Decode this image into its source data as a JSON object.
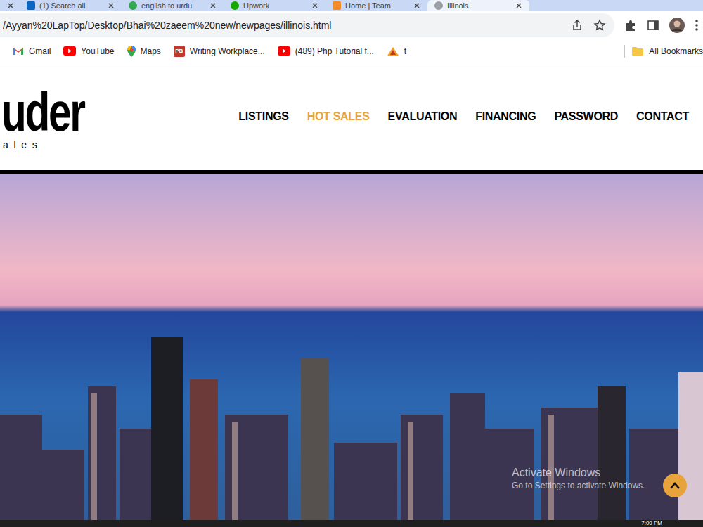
{
  "browser": {
    "tabs": [
      {
        "label": "(1) Search all",
        "kind": "linkedin",
        "selected": false
      },
      {
        "label": "english to urdu",
        "kind": "google",
        "selected": false
      },
      {
        "label": "Upwork",
        "kind": "upwork",
        "selected": false
      },
      {
        "label": "Home | Team",
        "kind": "site",
        "selected": false
      },
      {
        "label": "Illinois",
        "kind": "globe",
        "selected": true
      }
    ],
    "address": "/Ayyan%20LapTop/Desktop/Bhai%20zaeem%20new/newpages/illinois.html",
    "bookmarks": [
      {
        "label": "Gmail",
        "kind": "gmail"
      },
      {
        "label": "YouTube",
        "kind": "youtube"
      },
      {
        "label": "Maps",
        "kind": "maps"
      },
      {
        "label": "Writing Workplace...",
        "kind": "badge",
        "badge": "PB"
      },
      {
        "label": "(489) Php Tutorial f...",
        "kind": "youtube"
      },
      {
        "label": "t",
        "kind": "pma"
      }
    ],
    "all_bookmarks": "All Bookmarks"
  },
  "site": {
    "logo": {
      "main": "uder",
      "sub": "ales"
    },
    "nav": [
      {
        "label": "LISTINGS",
        "selected": false
      },
      {
        "label": "HOT SALES",
        "selected": true
      },
      {
        "label": "EVALUATION",
        "selected": false
      },
      {
        "label": "FINANCING",
        "selected": false
      },
      {
        "label": "PASSWORD",
        "selected": false
      },
      {
        "label": "CONTACT",
        "selected": false
      }
    ]
  },
  "windows_watermark": {
    "title": "Activate Windows",
    "subtitle": "Go to Settings to activate Windows."
  },
  "taskbar": {
    "clock": "7:09 PM"
  }
}
